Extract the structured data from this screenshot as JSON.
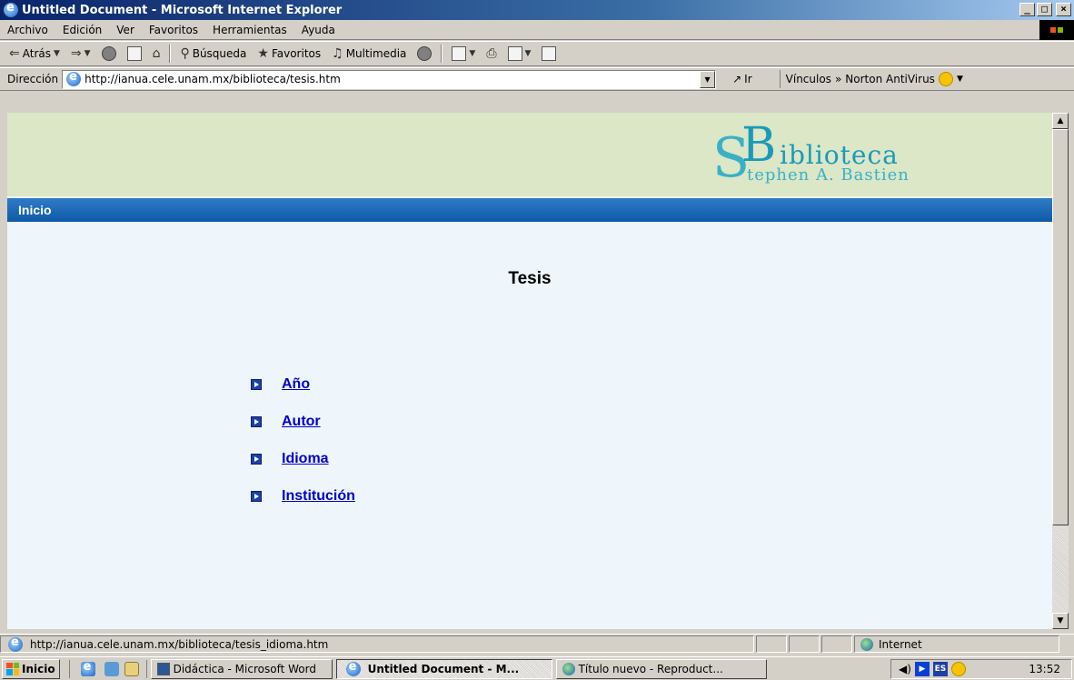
{
  "window": {
    "title": "Untitled Document - Microsoft Internet Explorer",
    "buttons": {
      "minimize": "_",
      "maximize": "□",
      "close": "×"
    }
  },
  "menu": [
    "Archivo",
    "Edición",
    "Ver",
    "Favoritos",
    "Herramientas",
    "Ayuda"
  ],
  "toolbar": {
    "back": "Atrás",
    "search": "Búsqueda",
    "favorites": "Favoritos",
    "multimedia": "Multimedia"
  },
  "address": {
    "label": "Dirección",
    "url": "http://ianua.cele.unam.mx/biblioteca/tesis.htm",
    "go": "Ir",
    "links_label": "Vínculos",
    "links_more": "»",
    "norton": "Norton AntiVirus"
  },
  "page": {
    "logo": {
      "s": "S",
      "b": "B",
      "iblioteca": "iblioteca",
      "stephen": "tephen A. Bastien"
    },
    "nav": "Inicio",
    "heading": "Tesis",
    "links": [
      "Año",
      "Autor",
      "Idioma",
      "Institución"
    ]
  },
  "status": {
    "url": "http://ianua.cele.unam.mx/biblioteca/tesis_idioma.htm",
    "zone": "Internet"
  },
  "taskbar": {
    "start": "Inicio",
    "tasks": [
      "Didáctica - Microsoft Word",
      "Untitled Document - M...",
      "Título nuevo - Reproduct..."
    ],
    "lang": "ES",
    "clock": "13:52"
  }
}
